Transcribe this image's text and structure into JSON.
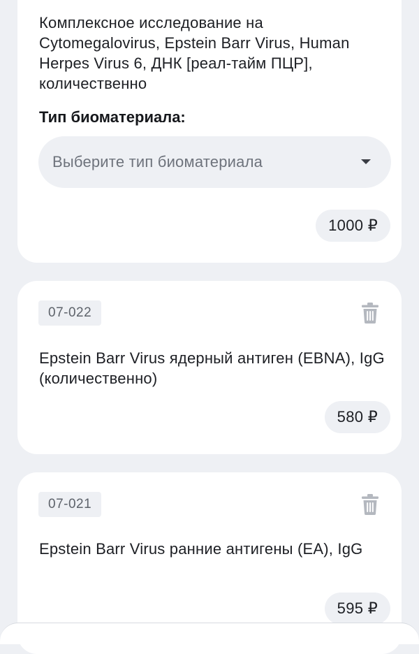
{
  "cards": [
    {
      "title": "Комплексное исследование на Cytomegalovirus, Epstein Barr Virus, Human Herpes Virus 6, ДНК [реал-тайм ПЦР], количественно",
      "biomaterial_label": "Тип биоматериала:",
      "biomaterial_placeholder": "Выберите тип биоматериала",
      "price": "1000 ₽"
    },
    {
      "code": "07-022",
      "title": "Epstein Barr Virus ядерный антиген (EBNA), IgG (количественно)",
      "price": "580 ₽"
    },
    {
      "code": "07-021",
      "title": "Epstein Barr Virus ранние антигены (EA), IgG",
      "price": "595 ₽"
    }
  ],
  "colors": {
    "page_background": "#eef0f4",
    "card_background": "#ffffff",
    "pill_background": "#eef0f4",
    "trash_icon": "#b4b8bf"
  },
  "icons": {
    "trash": "trash-icon",
    "dropdown": "chevron-down-icon"
  }
}
